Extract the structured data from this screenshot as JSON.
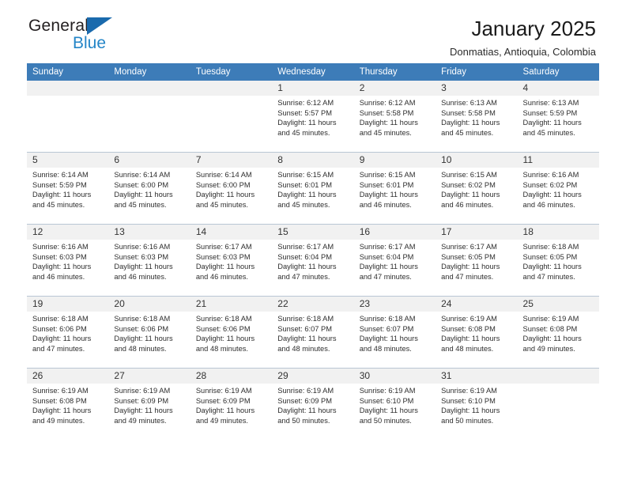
{
  "brand": {
    "name_top": "General",
    "name_bottom": "Blue",
    "accent_color": "#2485c7",
    "triangle_color": "#1a6aad"
  },
  "header": {
    "title": "January 2025",
    "subtitle": "Donmatias, Antioquia, Colombia"
  },
  "calendar": {
    "header_bg": "#3d7cb8",
    "header_text_color": "#ffffff",
    "daynum_bg": "#f1f1f1",
    "weekday_headers": [
      "Sunday",
      "Monday",
      "Tuesday",
      "Wednesday",
      "Thursday",
      "Friday",
      "Saturday"
    ],
    "weeks": [
      [
        {
          "day": "",
          "blank": true,
          "sunrise": "",
          "sunset": "",
          "daylight_line1": "",
          "daylight_line2": ""
        },
        {
          "day": "",
          "blank": true,
          "sunrise": "",
          "sunset": "",
          "daylight_line1": "",
          "daylight_line2": ""
        },
        {
          "day": "",
          "blank": true,
          "sunrise": "",
          "sunset": "",
          "daylight_line1": "",
          "daylight_line2": ""
        },
        {
          "day": "1",
          "sunrise": "Sunrise: 6:12 AM",
          "sunset": "Sunset: 5:57 PM",
          "daylight_line1": "Daylight: 11 hours",
          "daylight_line2": "and 45 minutes."
        },
        {
          "day": "2",
          "sunrise": "Sunrise: 6:12 AM",
          "sunset": "Sunset: 5:58 PM",
          "daylight_line1": "Daylight: 11 hours",
          "daylight_line2": "and 45 minutes."
        },
        {
          "day": "3",
          "sunrise": "Sunrise: 6:13 AM",
          "sunset": "Sunset: 5:58 PM",
          "daylight_line1": "Daylight: 11 hours",
          "daylight_line2": "and 45 minutes."
        },
        {
          "day": "4",
          "sunrise": "Sunrise: 6:13 AM",
          "sunset": "Sunset: 5:59 PM",
          "daylight_line1": "Daylight: 11 hours",
          "daylight_line2": "and 45 minutes."
        }
      ],
      [
        {
          "day": "5",
          "sunrise": "Sunrise: 6:14 AM",
          "sunset": "Sunset: 5:59 PM",
          "daylight_line1": "Daylight: 11 hours",
          "daylight_line2": "and 45 minutes."
        },
        {
          "day": "6",
          "sunrise": "Sunrise: 6:14 AM",
          "sunset": "Sunset: 6:00 PM",
          "daylight_line1": "Daylight: 11 hours",
          "daylight_line2": "and 45 minutes."
        },
        {
          "day": "7",
          "sunrise": "Sunrise: 6:14 AM",
          "sunset": "Sunset: 6:00 PM",
          "daylight_line1": "Daylight: 11 hours",
          "daylight_line2": "and 45 minutes."
        },
        {
          "day": "8",
          "sunrise": "Sunrise: 6:15 AM",
          "sunset": "Sunset: 6:01 PM",
          "daylight_line1": "Daylight: 11 hours",
          "daylight_line2": "and 45 minutes."
        },
        {
          "day": "9",
          "sunrise": "Sunrise: 6:15 AM",
          "sunset": "Sunset: 6:01 PM",
          "daylight_line1": "Daylight: 11 hours",
          "daylight_line2": "and 46 minutes."
        },
        {
          "day": "10",
          "sunrise": "Sunrise: 6:15 AM",
          "sunset": "Sunset: 6:02 PM",
          "daylight_line1": "Daylight: 11 hours",
          "daylight_line2": "and 46 minutes."
        },
        {
          "day": "11",
          "sunrise": "Sunrise: 6:16 AM",
          "sunset": "Sunset: 6:02 PM",
          "daylight_line1": "Daylight: 11 hours",
          "daylight_line2": "and 46 minutes."
        }
      ],
      [
        {
          "day": "12",
          "sunrise": "Sunrise: 6:16 AM",
          "sunset": "Sunset: 6:03 PM",
          "daylight_line1": "Daylight: 11 hours",
          "daylight_line2": "and 46 minutes."
        },
        {
          "day": "13",
          "sunrise": "Sunrise: 6:16 AM",
          "sunset": "Sunset: 6:03 PM",
          "daylight_line1": "Daylight: 11 hours",
          "daylight_line2": "and 46 minutes."
        },
        {
          "day": "14",
          "sunrise": "Sunrise: 6:17 AM",
          "sunset": "Sunset: 6:03 PM",
          "daylight_line1": "Daylight: 11 hours",
          "daylight_line2": "and 46 minutes."
        },
        {
          "day": "15",
          "sunrise": "Sunrise: 6:17 AM",
          "sunset": "Sunset: 6:04 PM",
          "daylight_line1": "Daylight: 11 hours",
          "daylight_line2": "and 47 minutes."
        },
        {
          "day": "16",
          "sunrise": "Sunrise: 6:17 AM",
          "sunset": "Sunset: 6:04 PM",
          "daylight_line1": "Daylight: 11 hours",
          "daylight_line2": "and 47 minutes."
        },
        {
          "day": "17",
          "sunrise": "Sunrise: 6:17 AM",
          "sunset": "Sunset: 6:05 PM",
          "daylight_line1": "Daylight: 11 hours",
          "daylight_line2": "and 47 minutes."
        },
        {
          "day": "18",
          "sunrise": "Sunrise: 6:18 AM",
          "sunset": "Sunset: 6:05 PM",
          "daylight_line1": "Daylight: 11 hours",
          "daylight_line2": "and 47 minutes."
        }
      ],
      [
        {
          "day": "19",
          "sunrise": "Sunrise: 6:18 AM",
          "sunset": "Sunset: 6:06 PM",
          "daylight_line1": "Daylight: 11 hours",
          "daylight_line2": "and 47 minutes."
        },
        {
          "day": "20",
          "sunrise": "Sunrise: 6:18 AM",
          "sunset": "Sunset: 6:06 PM",
          "daylight_line1": "Daylight: 11 hours",
          "daylight_line2": "and 48 minutes."
        },
        {
          "day": "21",
          "sunrise": "Sunrise: 6:18 AM",
          "sunset": "Sunset: 6:06 PM",
          "daylight_line1": "Daylight: 11 hours",
          "daylight_line2": "and 48 minutes."
        },
        {
          "day": "22",
          "sunrise": "Sunrise: 6:18 AM",
          "sunset": "Sunset: 6:07 PM",
          "daylight_line1": "Daylight: 11 hours",
          "daylight_line2": "and 48 minutes."
        },
        {
          "day": "23",
          "sunrise": "Sunrise: 6:18 AM",
          "sunset": "Sunset: 6:07 PM",
          "daylight_line1": "Daylight: 11 hours",
          "daylight_line2": "and 48 minutes."
        },
        {
          "day": "24",
          "sunrise": "Sunrise: 6:19 AM",
          "sunset": "Sunset: 6:08 PM",
          "daylight_line1": "Daylight: 11 hours",
          "daylight_line2": "and 48 minutes."
        },
        {
          "day": "25",
          "sunrise": "Sunrise: 6:19 AM",
          "sunset": "Sunset: 6:08 PM",
          "daylight_line1": "Daylight: 11 hours",
          "daylight_line2": "and 49 minutes."
        }
      ],
      [
        {
          "day": "26",
          "sunrise": "Sunrise: 6:19 AM",
          "sunset": "Sunset: 6:08 PM",
          "daylight_line1": "Daylight: 11 hours",
          "daylight_line2": "and 49 minutes."
        },
        {
          "day": "27",
          "sunrise": "Sunrise: 6:19 AM",
          "sunset": "Sunset: 6:09 PM",
          "daylight_line1": "Daylight: 11 hours",
          "daylight_line2": "and 49 minutes."
        },
        {
          "day": "28",
          "sunrise": "Sunrise: 6:19 AM",
          "sunset": "Sunset: 6:09 PM",
          "daylight_line1": "Daylight: 11 hours",
          "daylight_line2": "and 49 minutes."
        },
        {
          "day": "29",
          "sunrise": "Sunrise: 6:19 AM",
          "sunset": "Sunset: 6:09 PM",
          "daylight_line1": "Daylight: 11 hours",
          "daylight_line2": "and 50 minutes."
        },
        {
          "day": "30",
          "sunrise": "Sunrise: 6:19 AM",
          "sunset": "Sunset: 6:10 PM",
          "daylight_line1": "Daylight: 11 hours",
          "daylight_line2": "and 50 minutes."
        },
        {
          "day": "31",
          "sunrise": "Sunrise: 6:19 AM",
          "sunset": "Sunset: 6:10 PM",
          "daylight_line1": "Daylight: 11 hours",
          "daylight_line2": "and 50 minutes."
        },
        {
          "day": "",
          "blank": true,
          "sunrise": "",
          "sunset": "",
          "daylight_line1": "",
          "daylight_line2": ""
        }
      ]
    ]
  }
}
